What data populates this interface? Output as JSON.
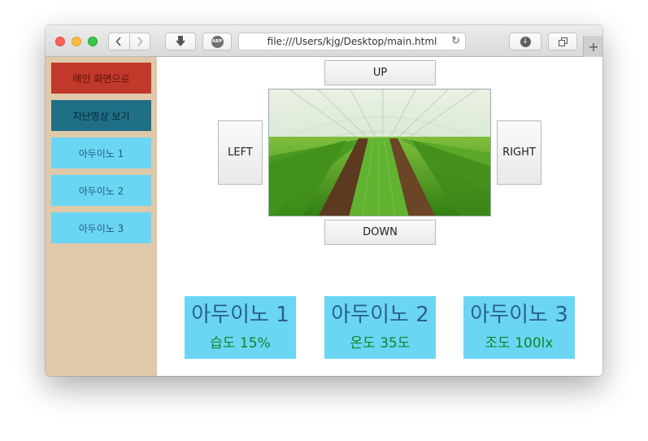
{
  "browser": {
    "url": "file:///Users/kjg/Desktop/main.html",
    "back_icon": "chevron-left-icon",
    "forward_icon": "chevron-right-icon",
    "abp_label": "ABP",
    "reload_icon": "reload-icon",
    "downloads_icon": "download-icon",
    "tabs_icon": "tabs-overview-icon",
    "newtab_label": "+"
  },
  "sidebar": {
    "items": [
      {
        "label": "메인 화면으로"
      },
      {
        "label": "지난영상 보기"
      },
      {
        "label": "아두이노 1"
      },
      {
        "label": "아두이노 2"
      },
      {
        "label": "아두이노 3"
      }
    ]
  },
  "controls": {
    "up": "UP",
    "down": "DOWN",
    "left": "LEFT",
    "right": "RIGHT"
  },
  "cards": [
    {
      "title": "아두이노 1",
      "value": "습도 15%"
    },
    {
      "title": "아두이노 2",
      "value": "온도 35도"
    },
    {
      "title": "아두이노 3",
      "value": "조도 100lx"
    }
  ],
  "colors": {
    "sidebar_bg": "#dfc9a8",
    "main_button": "#c0392b",
    "past_video_button": "#1f6f85",
    "arduino_button": "#6ad6f4",
    "card_title": "#2c5d96",
    "card_value": "#10852a"
  }
}
